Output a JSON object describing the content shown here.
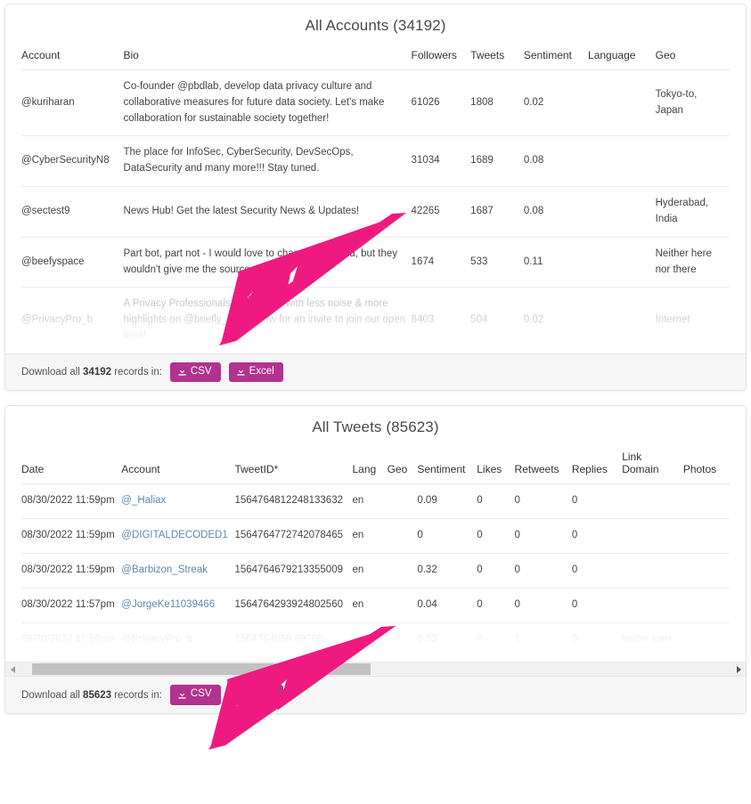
{
  "accounts_panel": {
    "title": "All Accounts (34192)",
    "columns": [
      "Account",
      "Bio",
      "Followers",
      "Tweets",
      "Sentiment",
      "Language",
      "Geo"
    ],
    "rows": [
      {
        "account": "@kuriharan",
        "bio": "Co-founder @pbdlab, develop data privacy culture and collaborative measures for future data society. Let's make collaboration for sustainable society together!",
        "followers": "61026",
        "tweets": "1808",
        "sentiment": "0.02",
        "language": "",
        "geo": "Tokyo-to, Japan",
        "faded": false
      },
      {
        "account": "@CyberSecurityN8",
        "bio": "The place for InfoSec, CyberSecurity, DevSecOps, DataSecurity and many more!!! Stay tuned.",
        "followers": "31034",
        "tweets": "1689",
        "sentiment": "0.08",
        "language": "",
        "geo": "",
        "faded": false
      },
      {
        "account": "@sectest9",
        "bio": "News Hub! Get the latest Security News & Updates!",
        "followers": "42265",
        "tweets": "1687",
        "sentiment": "0.08",
        "language": "",
        "geo": "Hyderabad, India",
        "faded": false
      },
      {
        "account": "@beefyspace",
        "bio": "Part bot, part not - I would love to change the world, but they wouldn't give me the source code",
        "followers": "1674",
        "tweets": "533",
        "sentiment": "0.11",
        "language": "",
        "geo": "Neither here nor there",
        "faded": false
      },
      {
        "account": "@PrivacyPro_b",
        "bio": "A Privacy Professionals community with less noise & more highlights on @briefly_tldr. Follow for an invite to join our open beta!",
        "followers": "8403",
        "tweets": "504",
        "sentiment": "0.02",
        "language": "",
        "geo": "Internet",
        "faded": true
      }
    ],
    "footer": {
      "prefix": "Download all ",
      "count": "34192",
      "suffix": " records in:",
      "csv_label": "CSV",
      "excel_label": "Excel",
      "icon": "download-icon"
    }
  },
  "tweets_panel": {
    "title": "All Tweets (85623)",
    "columns": [
      "Date",
      "Account",
      "TweetID*",
      "Lang",
      "Geo",
      "Sentiment",
      "Likes",
      "Retweets",
      "Replies",
      "Link Domain",
      "Photos"
    ],
    "link_domain_header_line1": "Link",
    "link_domain_header_line2": "Domain",
    "rows": [
      {
        "date": "08/30/2022 11:59pm",
        "account": "@_Haliax",
        "tweet_id": "1564764812248133632",
        "lang": "en",
        "geo": "",
        "sentiment": "0.09",
        "likes": "0",
        "retweets": "0",
        "replies": "0",
        "link_domain": "",
        "photos": "",
        "faded": false
      },
      {
        "date": "08/30/2022 11:59pm",
        "account": "@DIGITALDECODED1",
        "tweet_id": "1564764772742078465",
        "lang": "en",
        "geo": "",
        "sentiment": "0",
        "likes": "0",
        "retweets": "0",
        "replies": "0",
        "link_domain": "",
        "photos": "",
        "faded": false
      },
      {
        "date": "08/30/2022 11:59pm",
        "account": "@Barbizon_Streak",
        "tweet_id": "1564764679213355009",
        "lang": "en",
        "geo": "",
        "sentiment": "0.32",
        "likes": "0",
        "retweets": "0",
        "replies": "0",
        "link_domain": "",
        "photos": "",
        "faded": false
      },
      {
        "date": "08/30/2022 11:57pm",
        "account": "@JorgeKe11039466",
        "tweet_id": "1564764293924802560",
        "lang": "en",
        "geo": "",
        "sentiment": "0.04",
        "likes": "0",
        "retweets": "0",
        "replies": "0",
        "link_domain": "",
        "photos": "",
        "faded": false
      },
      {
        "date": "08/30/2022 11:56pm",
        "account": "@PrivacyPro_b",
        "tweet_id": "1564764058  89760",
        "lang": "en",
        "geo": "",
        "sentiment": "0.03",
        "likes": "0",
        "retweets": "1",
        "replies": "0",
        "link_domain": "twitter.com",
        "photos": "",
        "faded": true
      }
    ],
    "scrollbar": {
      "left_arrow": "triangle-left-icon",
      "right_arrow": "triangle-right-icon"
    },
    "footer": {
      "prefix": "Download all ",
      "count": "85623",
      "suffix": " records in:",
      "csv_label": "CSV",
      "excel_label": "Excel",
      "icon": "download-icon"
    }
  },
  "annotations": {
    "arrow_color": "#ef1a80",
    "arrows": [
      {
        "name": "arrow-pointing-to-accounts-excel-button"
      },
      {
        "name": "arrow-pointing-to-tweets-excel-button"
      }
    ]
  },
  "colors": {
    "button": "#b1338d",
    "link": "#5d8aa8",
    "arrow": "#ef1a80"
  }
}
